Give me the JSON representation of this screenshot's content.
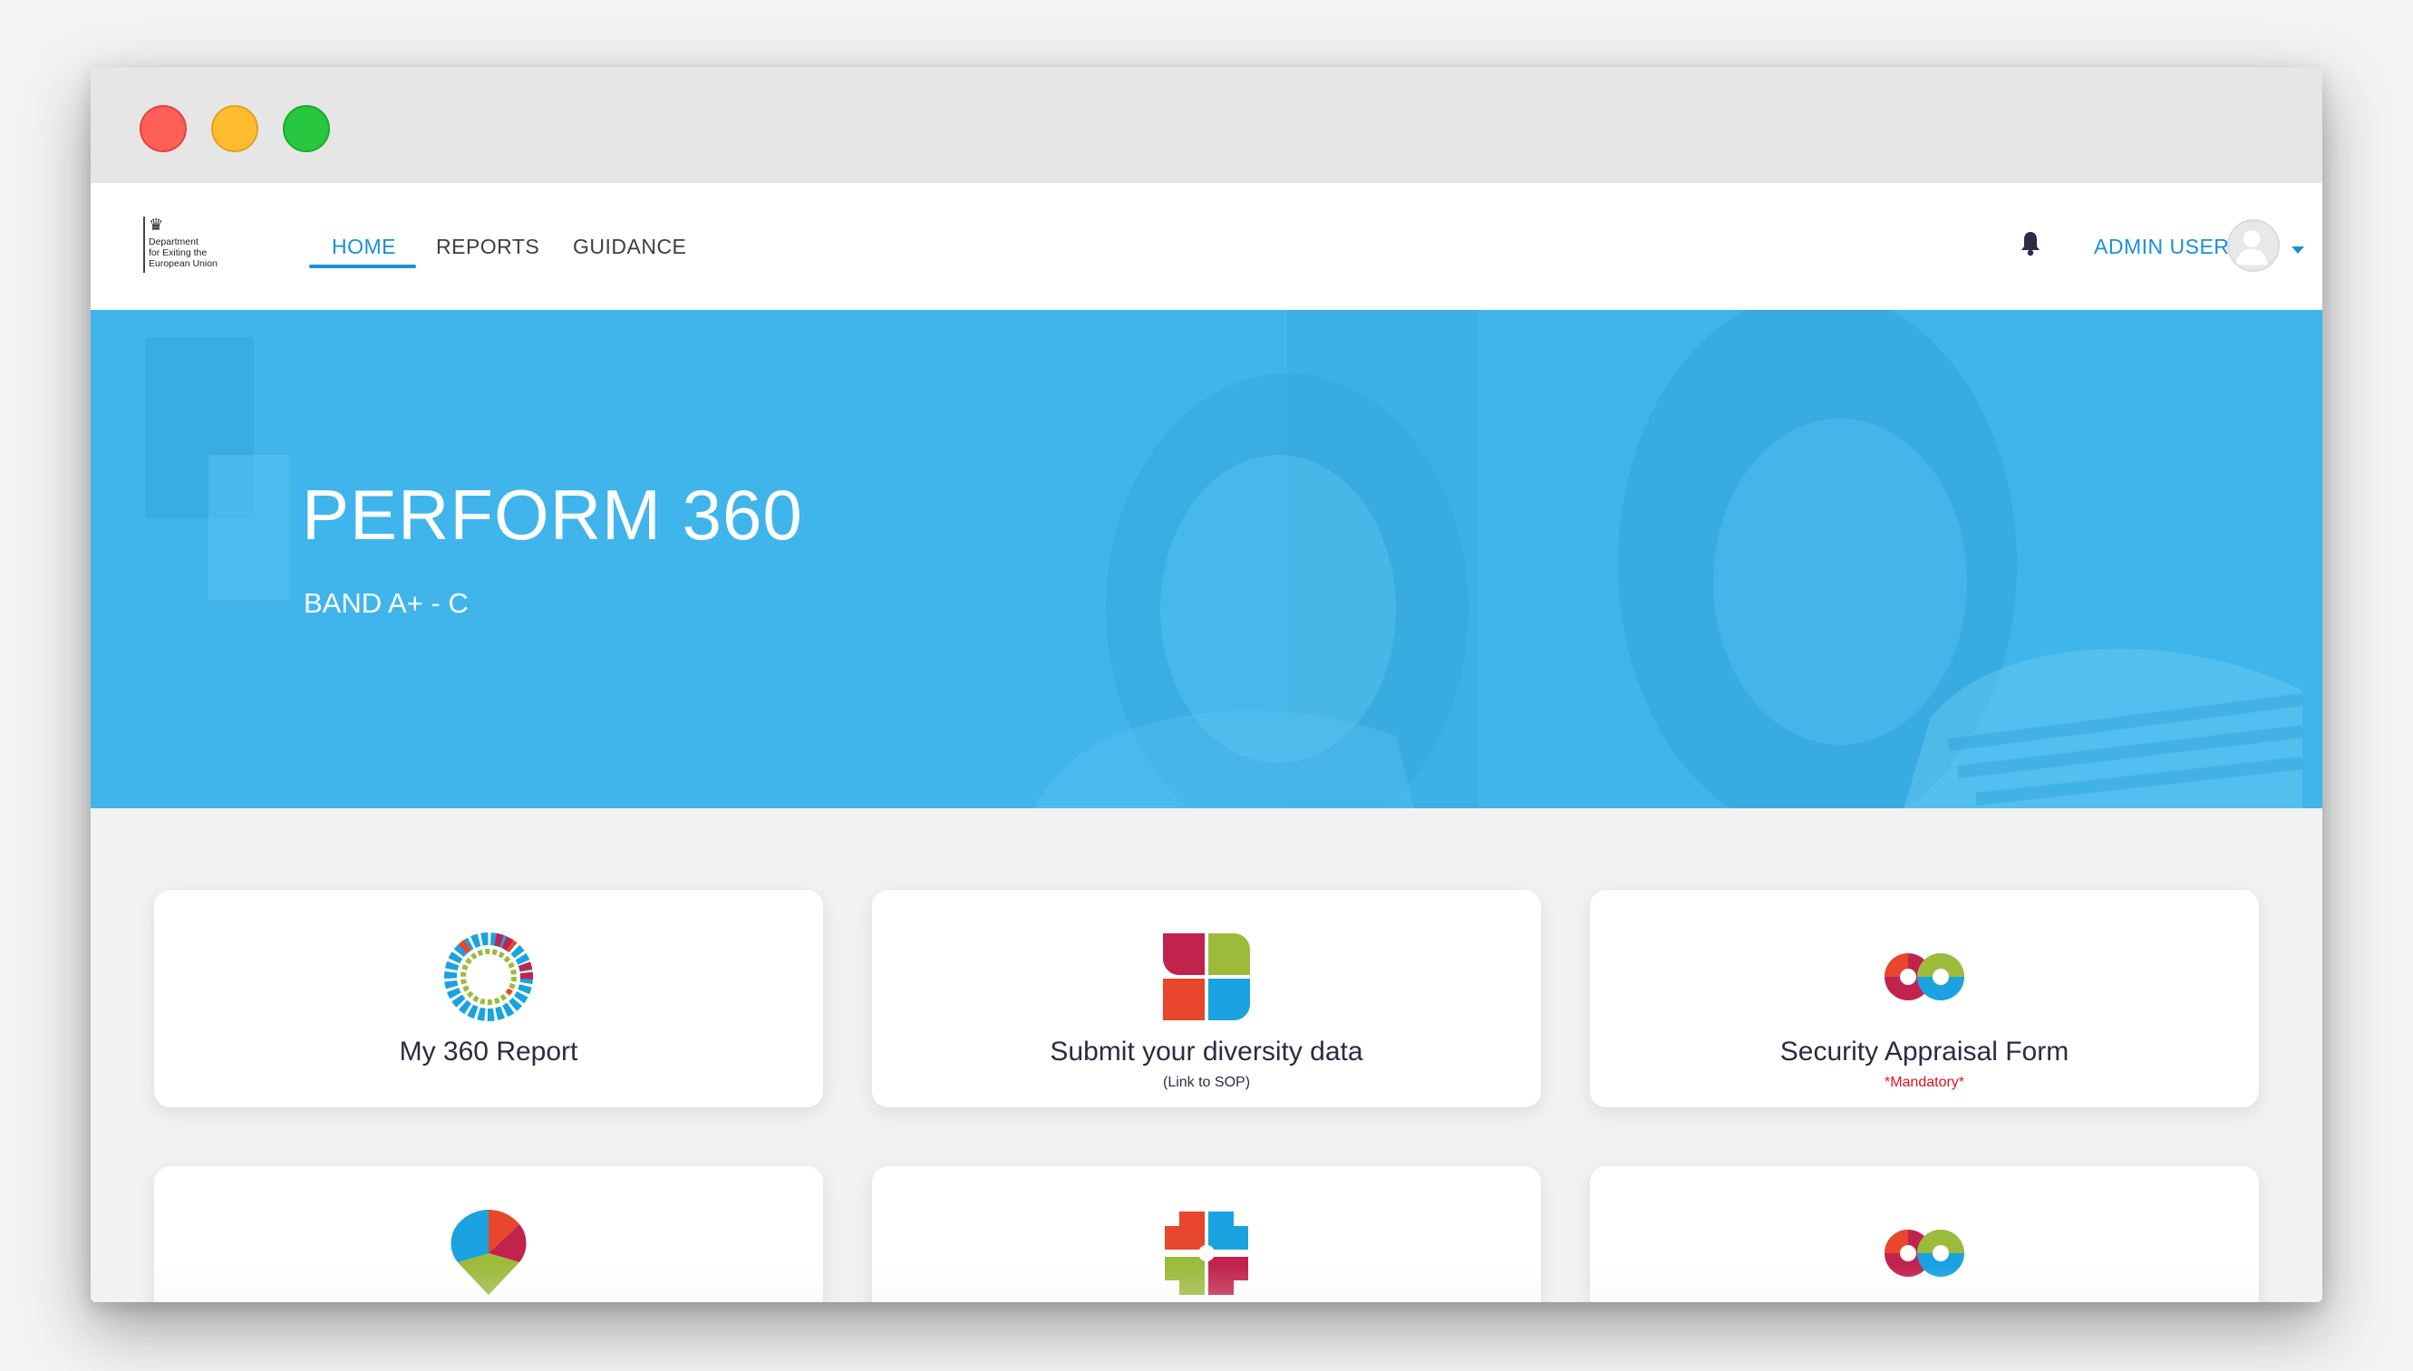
{
  "header": {
    "logo": {
      "lines": [
        "Department",
        "for Exiting the",
        "European Union"
      ]
    },
    "nav": [
      {
        "label": "HOME",
        "active": true
      },
      {
        "label": "REPORTS",
        "active": false
      },
      {
        "label": "GUIDANCE",
        "active": false
      }
    ],
    "user": {
      "label": "ADMIN USER"
    }
  },
  "hero": {
    "title": "PERFORM 360",
    "subtitle": "BAND A+ - C"
  },
  "cards": [
    {
      "title": "My 360 Report",
      "icon": "ring-chart-icon"
    },
    {
      "title": "Submit your diversity data",
      "note": "(Link to SOP)",
      "icon": "four-petal-icon"
    },
    {
      "title": "Security Appraisal Form",
      "note": "*Mandatory*",
      "icon": "infinity-rings-icon"
    },
    {
      "icon": "location-pin-icon"
    },
    {
      "icon": "puzzle-gear-icon"
    },
    {
      "icon": "infinity-rings-icon"
    }
  ],
  "colors": {
    "accent": "#1a8fd6",
    "hero": "#3db4ea",
    "mandatory": "#e0121a",
    "icon_red": "#e8462d",
    "icon_magenta": "#c1234d",
    "icon_green": "#9dbb3b",
    "icon_blue": "#1aa3e0"
  }
}
